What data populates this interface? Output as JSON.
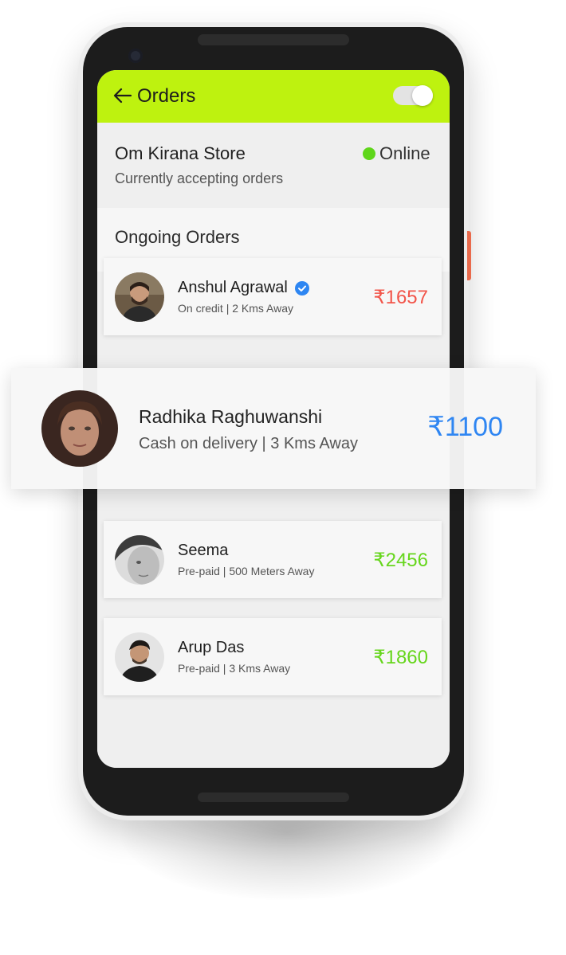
{
  "app_bar": {
    "title": "Orders",
    "toggle_on": true
  },
  "store": {
    "name": "Om Kirana Store",
    "subtitle": "Currently accepting orders",
    "status": "Online"
  },
  "orders": {
    "section_title": "Ongoing Orders",
    "items": [
      {
        "name": "Anshul Agrawal",
        "verified": true,
        "meta": "On credit | 2 Kms Away",
        "amount": "₹1657",
        "amount_color": "#f2554a"
      },
      {
        "name": "Seema",
        "verified": false,
        "meta": "Pre-paid | 500 Meters Away",
        "amount": "₹2456",
        "amount_color": "#66d61c"
      },
      {
        "name": "Arup Das",
        "verified": false,
        "meta": "Pre-paid | 3 Kms Away",
        "amount": "₹1860",
        "amount_color": "#66d61c"
      }
    ],
    "featured": {
      "name": "Radhika Raghuwanshi",
      "meta": "Cash on delivery | 3 Kms Away",
      "amount": "₹1100",
      "amount_color": "#2f86f2"
    }
  },
  "colors": {
    "accent": "#bef20f",
    "online": "#5fd61a",
    "verified": "#2e86f2"
  },
  "icons": {
    "back": "arrow-left-icon",
    "verified": "verified-check-icon"
  }
}
